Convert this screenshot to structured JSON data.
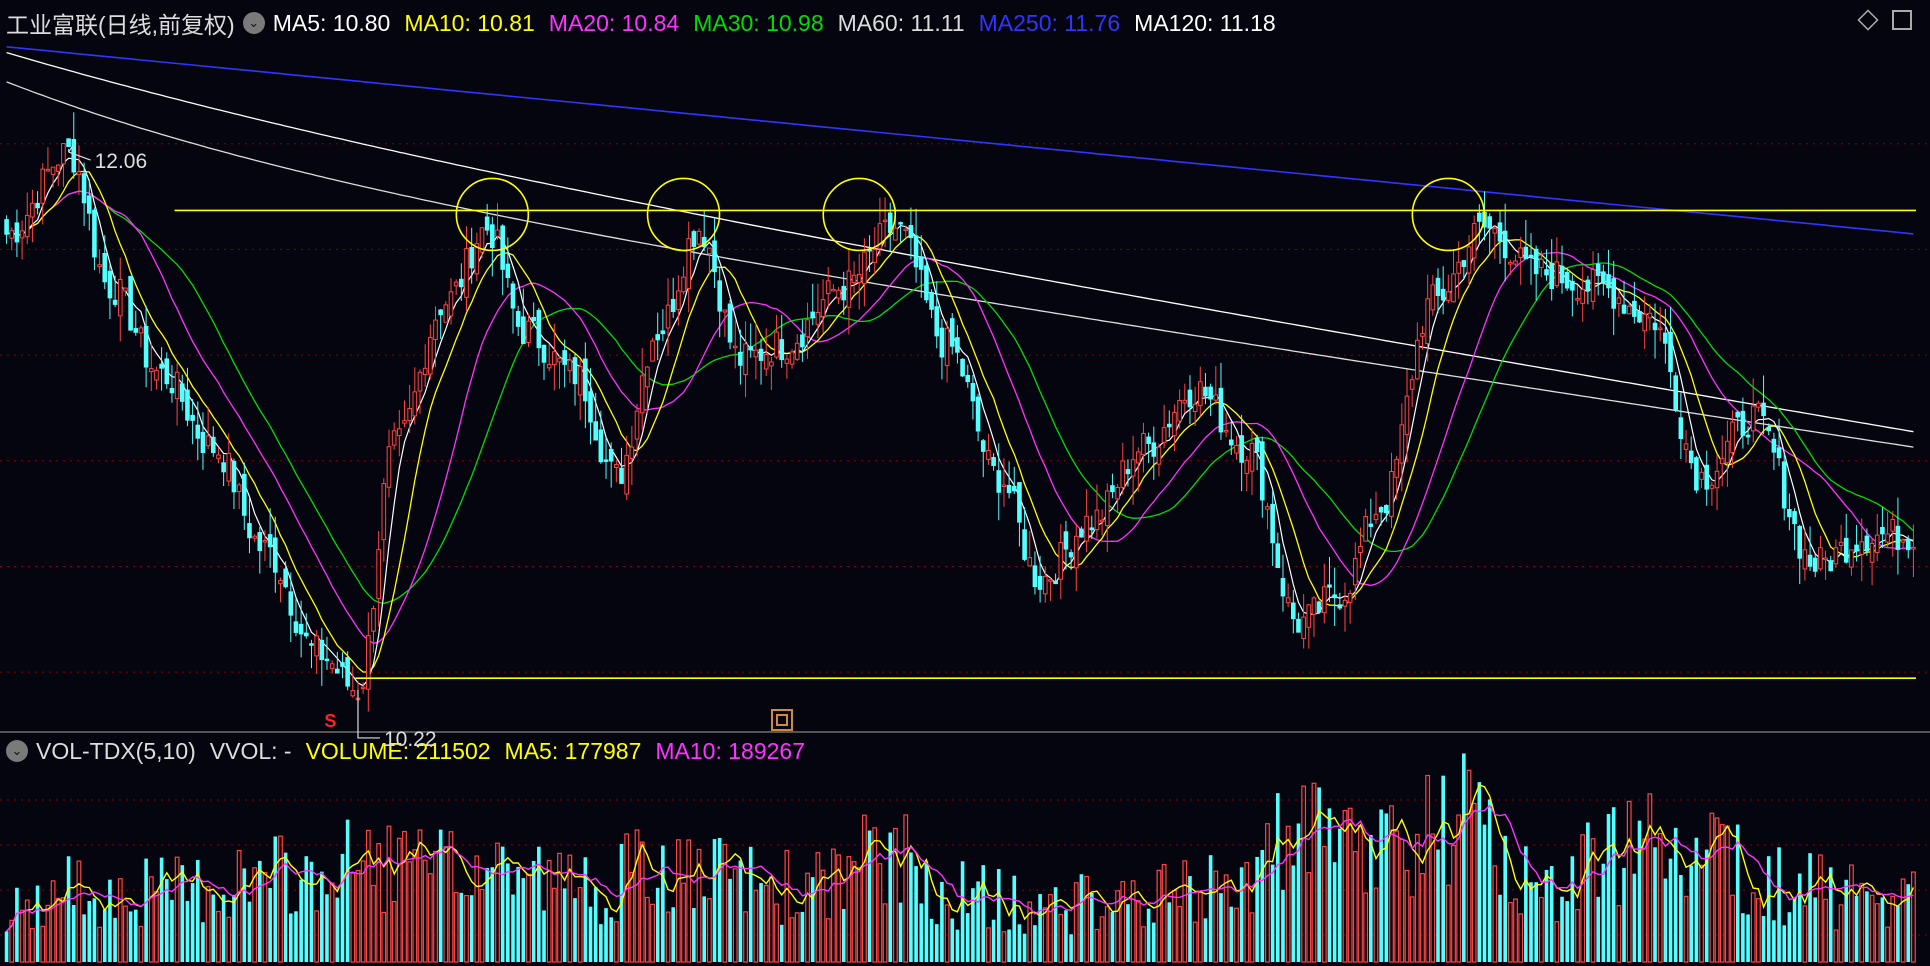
{
  "header": {
    "title": "工业富联(日线,前复权)",
    "ma": [
      {
        "label": "MA5: 10.80",
        "color": "#ffffff"
      },
      {
        "label": "MA10: 10.81",
        "color": "#ffff00"
      },
      {
        "label": "MA20: 10.84",
        "color": "#ff33ff"
      },
      {
        "label": "MA30: 10.98",
        "color": "#00dd00"
      },
      {
        "label": "MA60: 11.11",
        "color": "#dddddd"
      },
      {
        "label": "MA250: 11.76",
        "color": "#3333ff"
      },
      {
        "label": "MA120: 11.18",
        "color": "#ffffff"
      }
    ]
  },
  "volume_header": {
    "name": "VOL-TDX(5,10)",
    "vvol": "VVOL: -",
    "volume": "VOLUME: 211502",
    "ma5": "MA5: 177987",
    "ma10": "MA10: 189267"
  },
  "colors": {
    "up": "#ff4444",
    "down": "#54ffff",
    "grid": "#8b0000",
    "annotation": "#ffff00",
    "ma5": "#ffffff",
    "ma10": "#ffff00",
    "ma20": "#ff33ff",
    "ma30": "#00dd00",
    "ma60": "#dddddd",
    "ma120": "#ffffff",
    "ma250": "#3333ff"
  },
  "chart_data": {
    "type": "candlestick",
    "ylim": [
      10.1,
      12.45
    ],
    "high_label": "12.06",
    "low_label": "10.22",
    "resistance": 11.86,
    "support": 10.26,
    "marker": "S",
    "anchors": [
      [
        0,
        11.78
      ],
      [
        12,
        12.06
      ],
      [
        20,
        11.6
      ],
      [
        30,
        11.3
      ],
      [
        40,
        11.05
      ],
      [
        50,
        10.7
      ],
      [
        60,
        10.35
      ],
      [
        68,
        10.22
      ],
      [
        75,
        11.05
      ],
      [
        85,
        11.55
      ],
      [
        93,
        11.8
      ],
      [
        100,
        11.45
      ],
      [
        110,
        11.3
      ],
      [
        118,
        10.95
      ],
      [
        126,
        11.45
      ],
      [
        134,
        11.8
      ],
      [
        142,
        11.35
      ],
      [
        150,
        11.4
      ],
      [
        162,
        11.6
      ],
      [
        172,
        11.8
      ],
      [
        182,
        11.4
      ],
      [
        192,
        10.95
      ],
      [
        200,
        10.6
      ],
      [
        210,
        10.8
      ],
      [
        220,
        11.05
      ],
      [
        230,
        11.25
      ],
      [
        240,
        11.05
      ],
      [
        250,
        10.45
      ],
      [
        258,
        10.55
      ],
      [
        266,
        10.85
      ],
      [
        276,
        11.55
      ],
      [
        286,
        11.8
      ],
      [
        296,
        11.65
      ],
      [
        308,
        11.6
      ],
      [
        318,
        11.5
      ],
      [
        328,
        10.95
      ],
      [
        338,
        11.15
      ],
      [
        350,
        10.65
      ],
      [
        360,
        10.75
      ],
      [
        369,
        10.75
      ]
    ],
    "volume": {
      "ylim": [
        0,
        600000
      ],
      "anchors": [
        [
          0,
          170000
        ],
        [
          15,
          240000
        ],
        [
          30,
          230000
        ],
        [
          45,
          270000
        ],
        [
          60,
          280000
        ],
        [
          70,
          330000
        ],
        [
          85,
          290000
        ],
        [
          95,
          320000
        ],
        [
          110,
          250000
        ],
        [
          125,
          290000
        ],
        [
          140,
          270000
        ],
        [
          155,
          240000
        ],
        [
          170,
          340000
        ],
        [
          185,
          220000
        ],
        [
          200,
          180000
        ],
        [
          215,
          200000
        ],
        [
          230,
          220000
        ],
        [
          240,
          300000
        ],
        [
          250,
          400000
        ],
        [
          262,
          350000
        ],
        [
          272,
          420000
        ],
        [
          282,
          450000
        ],
        [
          295,
          260000
        ],
        [
          308,
          320000
        ],
        [
          320,
          480000
        ],
        [
          333,
          350000
        ],
        [
          345,
          250000
        ],
        [
          358,
          210000
        ],
        [
          369,
          211502
        ]
      ]
    }
  }
}
